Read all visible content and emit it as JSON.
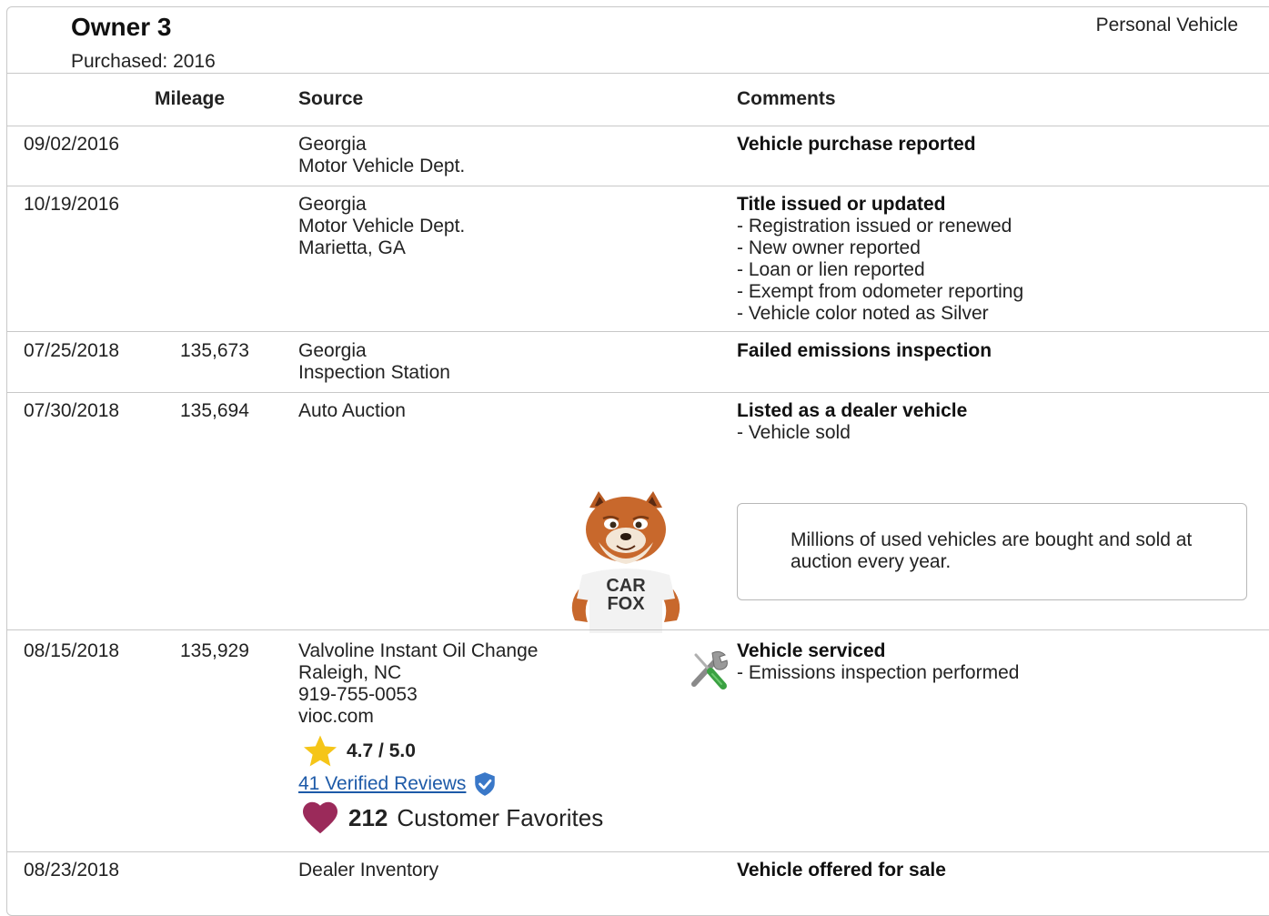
{
  "owner": {
    "title": "Owner 3",
    "purchased": "Purchased: 2016",
    "vehicle_type": "Personal Vehicle"
  },
  "columns": {
    "mileage": "Mileage",
    "source": "Source",
    "comments": "Comments"
  },
  "rows": [
    {
      "date": "09/02/2016",
      "mileage": "",
      "source": [
        "Georgia",
        "Motor Vehicle Dept."
      ],
      "comment_title": "Vehicle purchase reported",
      "comment_details": []
    },
    {
      "date": "10/19/2016",
      "mileage": "",
      "source": [
        "Georgia",
        "Motor Vehicle Dept.",
        "Marietta, GA"
      ],
      "comment_title": "Title issued or updated",
      "comment_details": [
        "- Registration issued or renewed",
        "- New owner reported",
        "- Loan or lien reported",
        "- Exempt from odometer reporting",
        "- Vehicle color noted as Silver"
      ]
    },
    {
      "date": "07/25/2018",
      "mileage": "135,673",
      "source": [
        "Georgia",
        "Inspection Station"
      ],
      "comment_title": "Failed emissions inspection",
      "comment_details": []
    },
    {
      "date": "07/30/2018",
      "mileage": "135,694",
      "source": [
        "Auto Auction"
      ],
      "comment_title": "Listed as a dealer vehicle",
      "comment_details": [
        "- Vehicle sold"
      ],
      "callout": "Millions of used vehicles are bought and sold at auction every year."
    },
    {
      "date": "08/15/2018",
      "mileage": "135,929",
      "source": [
        "Valvoline Instant Oil Change",
        "Raleigh, NC",
        "919-755-0053",
        "vioc.com"
      ],
      "comment_title": "Vehicle serviced",
      "comment_details": [
        "- Emissions inspection performed"
      ],
      "rating": "4.7 / 5.0",
      "reviews_link": "41 Verified Reviews",
      "favorites_count": "212",
      "favorites_label": "Customer Favorites"
    },
    {
      "date": "08/23/2018",
      "mileage": "",
      "source": [
        "Dealer Inventory"
      ],
      "comment_title": "Vehicle offered for sale",
      "comment_details": []
    }
  ],
  "mascot": {
    "shirt_line1": "CAR",
    "shirt_line2": "FOX"
  },
  "icons": {
    "service": "wrench-screwdriver-icon",
    "rating": "star-icon",
    "verified": "verified-shield-icon",
    "favorites": "heart-icon"
  },
  "colors": {
    "link": "#1d5aa8",
    "star": "#f5c518",
    "heart": "#9b2a5a",
    "shield": "#3a78c8",
    "border": "#c8c8c8"
  }
}
